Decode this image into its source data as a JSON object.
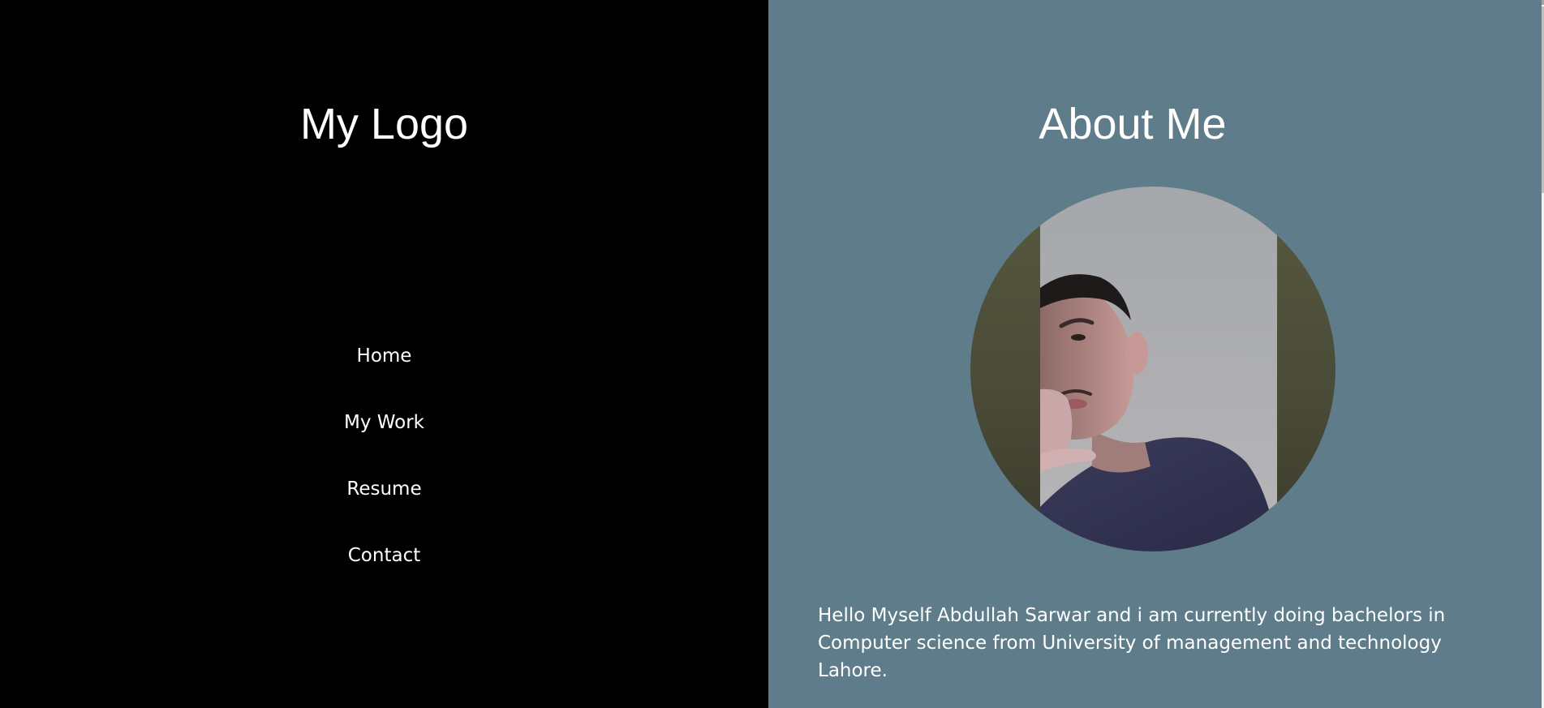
{
  "sidebar": {
    "logo": "My Logo",
    "nav": [
      {
        "label": "Home"
      },
      {
        "label": "My Work"
      },
      {
        "label": "Resume"
      },
      {
        "label": "Contact"
      }
    ]
  },
  "about": {
    "title": "About Me",
    "bio": "Hello Myself Abdullah Sarwar and i am currently doing bachelors in Computer science from University of management and technology Lahore."
  },
  "colors": {
    "sidebar_bg": "#000000",
    "content_bg": "#5f7c8a",
    "text": "#ffffff"
  },
  "icons": {
    "profile_photo": "profile-photo"
  }
}
